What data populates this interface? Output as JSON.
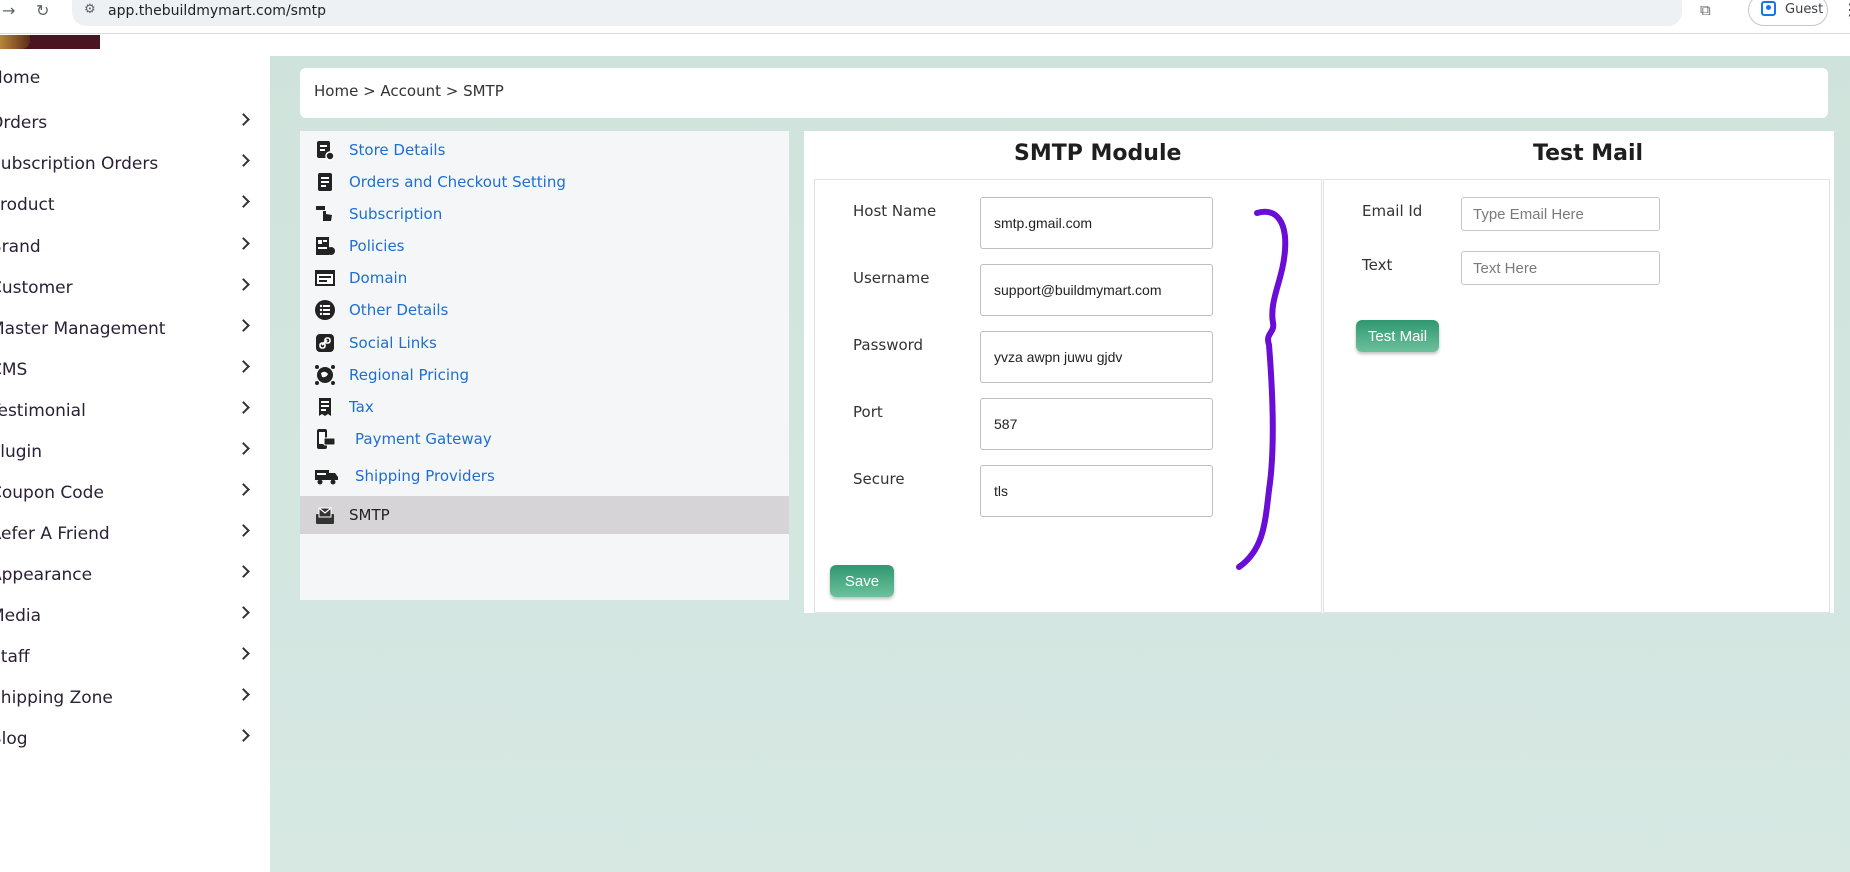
{
  "browser": {
    "url": "app.thebuildmymart.com/smtp",
    "profile_label": "Guest",
    "forward_icon": "forward-arrow-icon",
    "reload_icon": "reload-icon",
    "site_settings_icon": "tune-icon",
    "search_tab_icon": "search-tab-icon",
    "profile_icon": "profile-icon",
    "menu_icon": "kebab-menu-icon"
  },
  "sidebar": {
    "items": [
      {
        "label": "Home",
        "has_chevron": false
      },
      {
        "label": "Orders",
        "has_chevron": true
      },
      {
        "label": "Subscription Orders",
        "has_chevron": true
      },
      {
        "label": "Product",
        "has_chevron": true
      },
      {
        "label": "Brand",
        "has_chevron": true
      },
      {
        "label": "Customer",
        "has_chevron": true
      },
      {
        "label": "Master Management",
        "has_chevron": true
      },
      {
        "label": "CMS",
        "has_chevron": true
      },
      {
        "label": "Testimonial",
        "has_chevron": true
      },
      {
        "label": "Plugin",
        "has_chevron": true
      },
      {
        "label": "Coupon Code",
        "has_chevron": true
      },
      {
        "label": "Refer A Friend",
        "has_chevron": true
      },
      {
        "label": "Appearance",
        "has_chevron": true
      },
      {
        "label": "Media",
        "has_chevron": true
      },
      {
        "label": "Staff",
        "has_chevron": true
      },
      {
        "label": "Shipping Zone",
        "has_chevron": true
      },
      {
        "label": "Blog",
        "has_chevron": true
      }
    ]
  },
  "breadcrumb": {
    "text": "Home > Account > SMTP"
  },
  "settings_menu": {
    "items": [
      {
        "label": "Store Details",
        "icon": "store-document-icon",
        "active": false
      },
      {
        "label": "Orders and Checkout Setting",
        "icon": "document-icon",
        "active": false
      },
      {
        "label": "Subscription",
        "icon": "hand-tap-icon",
        "active": false
      },
      {
        "label": "Policies",
        "icon": "policy-icon",
        "active": false
      },
      {
        "label": "Domain",
        "icon": "browser-window-icon",
        "active": false
      },
      {
        "label": "Other Details",
        "icon": "list-circle-icon",
        "active": false
      },
      {
        "label": "Social Links",
        "icon": "link-icon",
        "active": false
      },
      {
        "label": "Regional Pricing",
        "icon": "globe-pricing-icon",
        "active": false
      },
      {
        "label": "Tax",
        "icon": "tax-receipt-icon",
        "active": false
      },
      {
        "label": "Payment Gateway",
        "icon": "phone-card-icon",
        "active": false
      },
      {
        "label": "Shipping Providers",
        "icon": "delivery-truck-icon",
        "active": false
      },
      {
        "label": "SMTP",
        "icon": "mail-tray-icon",
        "active": true
      }
    ]
  },
  "smtp": {
    "title": "SMTP Module",
    "fields": [
      {
        "label": "Host Name",
        "value": "smtp.gmail.com"
      },
      {
        "label": "Username",
        "value": "support@buildmymart.com"
      },
      {
        "label": "Password",
        "value": "yvza awpn juwu gjdv"
      },
      {
        "label": "Port",
        "value": "587"
      },
      {
        "label": "Secure",
        "value": "tls"
      }
    ],
    "save_label": "Save"
  },
  "test_mail": {
    "title": "Test Mail",
    "email_label": "Email Id",
    "email_placeholder": "Type Email Here",
    "text_label": "Text",
    "text_placeholder": "Text Here",
    "button_label": "Test Mail"
  },
  "colors": {
    "link_blue": "#1e6fd0",
    "button_green": "#2f9771",
    "annotation_purple": "#6a0dd6",
    "main_bg": "#cfe3dc"
  }
}
